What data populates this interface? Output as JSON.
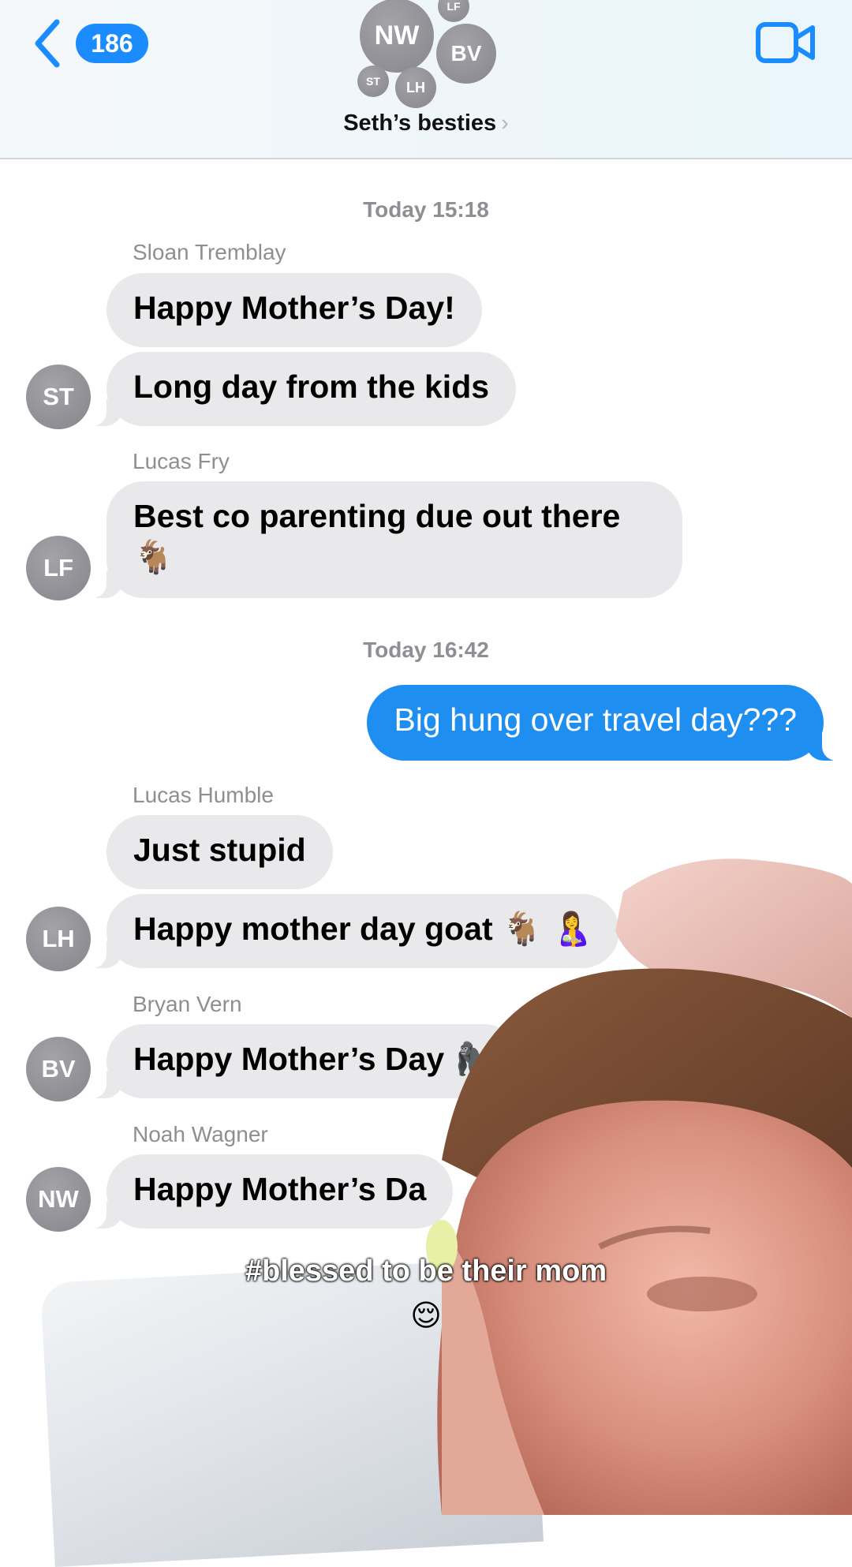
{
  "header": {
    "back_count": "186",
    "group_name": "Seth’s besties",
    "group_name_chevron": "›",
    "members": [
      "NW",
      "BV",
      "LF",
      "ST",
      "LH"
    ]
  },
  "chat": {
    "timestamps": [
      "Today 15:18",
      "Today 16:42"
    ],
    "messages": [
      {
        "sender": "Sloan Tremblay",
        "initials": "ST",
        "texts": [
          "Happy Mother’s Day!",
          "Long day from the kids"
        ]
      },
      {
        "sender": "Lucas Fry",
        "initials": "LF",
        "text": "Best co parenting due out there",
        "emoji": "🐐"
      },
      {
        "outgoing": "Big hung over travel day???"
      },
      {
        "sender": "Lucas Humble",
        "initials": "LH",
        "texts": [
          "Just stupid",
          "Happy mother day goat"
        ],
        "emoji": "🐐 🤱"
      },
      {
        "sender": "Bryan Vern",
        "initials": "BV",
        "text": "Happy Mother’s Day",
        "emoji": "🦍"
      },
      {
        "sender": "Noah Wagner",
        "initials": "NW",
        "text": "Happy Mother’s Da"
      }
    ]
  },
  "overlay": {
    "caption": "#blessed to be their mom",
    "caption_emoji": "😌"
  },
  "colors": {
    "accent": "#1a8cff",
    "outgoing_bubble": "#1f8ef1",
    "incoming_bubble": "#e9e9eb",
    "avatar": "#8e8e93"
  },
  "icons": [
    "chevron-left-icon",
    "video-camera-icon",
    "chevron-right-icon"
  ]
}
